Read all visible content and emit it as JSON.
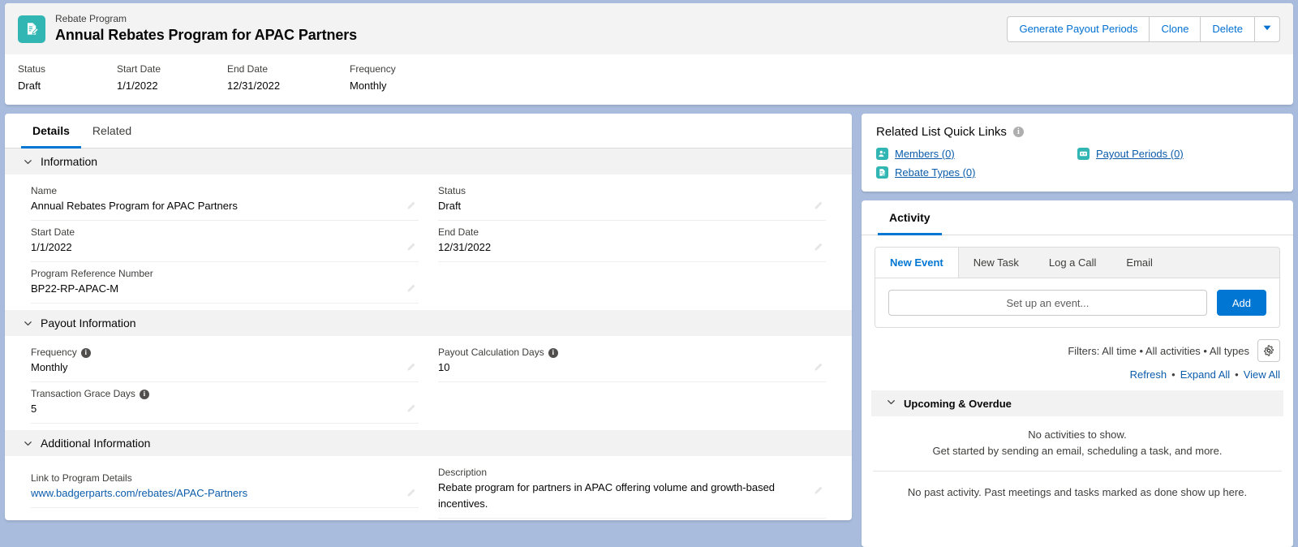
{
  "header": {
    "icon_name": "rebate-program-icon",
    "eyebrow": "Rebate Program",
    "title": "Annual Rebates Program for APAC Partners",
    "actions": [
      {
        "label": "Generate Payout Periods",
        "name": "generate-payout-periods-button"
      },
      {
        "label": "Clone",
        "name": "clone-button"
      },
      {
        "label": "Delete",
        "name": "delete-button"
      }
    ],
    "more_actions_icon": "chevron-down-icon",
    "highlight_fields": [
      {
        "label": "Status",
        "value": "Draft"
      },
      {
        "label": "Start Date",
        "value": "1/1/2022"
      },
      {
        "label": "End Date",
        "value": "12/31/2022"
      },
      {
        "label": "Frequency",
        "value": "Monthly"
      }
    ]
  },
  "details": {
    "tabs": [
      {
        "label": "Details",
        "active": true
      },
      {
        "label": "Related",
        "active": false
      }
    ],
    "sections": [
      {
        "title": "Information",
        "left": [
          {
            "label": "Name",
            "value": "Annual Rebates Program for APAC Partners",
            "info": false,
            "link": false
          },
          {
            "label": "Start Date",
            "value": "1/1/2022",
            "info": false,
            "link": false
          },
          {
            "label": "Program Reference Number",
            "value": "BP22-RP-APAC-M",
            "info": false,
            "link": false
          }
        ],
        "right": [
          {
            "label": "Status",
            "value": "Draft",
            "info": false,
            "link": false
          },
          {
            "label": "End Date",
            "value": "12/31/2022",
            "info": false,
            "link": false
          }
        ]
      },
      {
        "title": "Payout Information",
        "left": [
          {
            "label": "Frequency",
            "value": "Monthly",
            "info": true,
            "link": false
          },
          {
            "label": "Transaction Grace Days",
            "value": "5",
            "info": true,
            "link": false
          }
        ],
        "right": [
          {
            "label": "Payout Calculation Days",
            "value": "10",
            "info": true,
            "link": false
          }
        ]
      },
      {
        "title": "Additional Information",
        "left": [
          {
            "label": "Link to Program Details",
            "value": "www.badgerparts.com/rebates/APAC-Partners",
            "info": false,
            "link": true
          }
        ],
        "right": [
          {
            "label": "Description",
            "value": "Rebate program for partners in APAC offering volume and growth-based incentives.",
            "info": false,
            "link": false
          }
        ]
      }
    ],
    "edit_icon_name": "pencil-icon",
    "collapse_icon_name": "chevron-down-icon"
  },
  "quick_links": {
    "title": "Related List Quick Links",
    "info_icon": "info-icon",
    "items": [
      {
        "label": "Members (0)",
        "icon": "members-icon"
      },
      {
        "label": "Payout Periods (0)",
        "icon": "payout-periods-icon"
      },
      {
        "label": "Rebate Types (0)",
        "icon": "rebate-types-icon"
      }
    ]
  },
  "activity": {
    "tabs": [
      {
        "label": "Activity",
        "active": true
      }
    ],
    "composer_tabs": [
      {
        "label": "New Event",
        "active": true
      },
      {
        "label": "New Task",
        "active": false
      },
      {
        "label": "Log a Call",
        "active": false
      },
      {
        "label": "Email",
        "active": false
      }
    ],
    "event_input_placeholder": "Set up an event...",
    "event_input_value": "",
    "add_label": "Add",
    "filters_text": "Filters: All time • All activities • All types",
    "filter_settings_icon": "gear-icon",
    "links": [
      {
        "label": "Refresh"
      },
      {
        "label": "Expand All"
      },
      {
        "label": "View All"
      }
    ],
    "link_separator": "•",
    "upcoming_section_title": "Upcoming & Overdue",
    "empty_title": "No activities to show.",
    "empty_subtitle": "Get started by sending an email, scheduling a task, and more.",
    "past_activity_text": "No past activity. Past meetings and tasks marked as done show up here."
  },
  "colors": {
    "page_background": "#a9bcdd",
    "brand_blue": "#0176d3",
    "link_blue": "#0b5cab",
    "icon_teal": "#31b6b4",
    "section_grey": "#f3f2f2"
  }
}
